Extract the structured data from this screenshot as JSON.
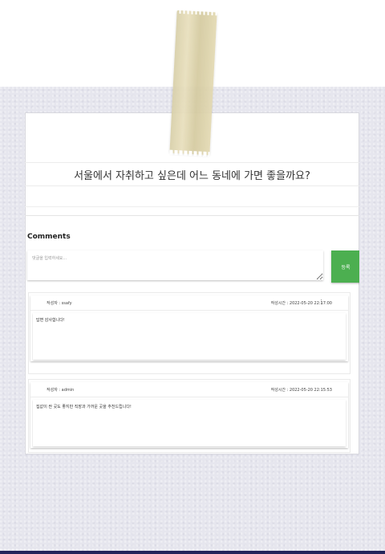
{
  "post": {
    "title": "서울에서 자취하고 싶은데 어느 동네에 가면 좋을까요?"
  },
  "comments_section": {
    "label": "Comments",
    "input_placeholder": "댓글을 입력하세요...",
    "submit_label": "등록"
  },
  "comments": [
    {
      "writer_label": "작성자 : ssafy",
      "time_label": "작성시간 : 2022-05-20 22:17:00",
      "text": "답변 감사합니다!"
    },
    {
      "writer_label": "작성자 : admin",
      "time_label": "작성시간 : 2022-05-20 22:15:53",
      "text": "집값이 싼 곳도 좋지만 직장과 가까운 곳을 추천드립니다!"
    }
  ],
  "colors": {
    "accent": "#4caf50",
    "frame": "#e6e6ee",
    "tape": "#ddd3ab"
  }
}
